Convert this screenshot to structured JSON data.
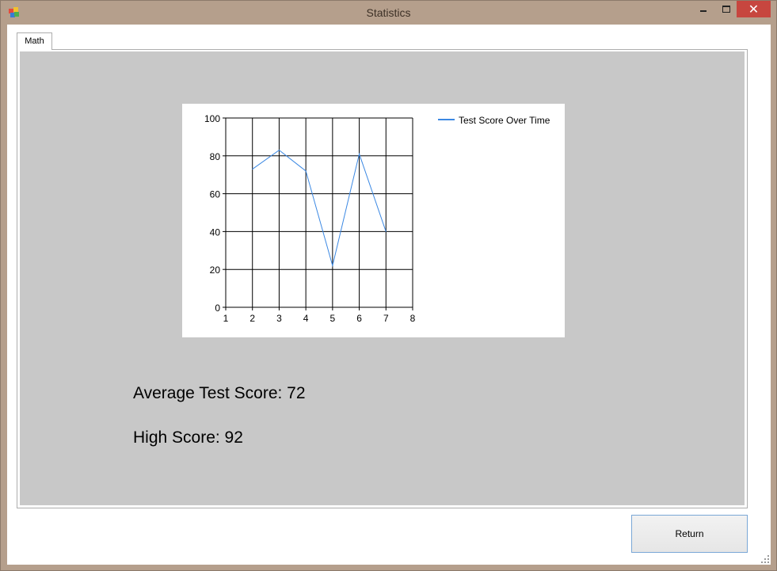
{
  "window": {
    "title": "Statistics"
  },
  "tabs": [
    {
      "label": "Math"
    }
  ],
  "chart_data": {
    "type": "line",
    "legend": "Test Score Over Time",
    "legend_position": "top-right",
    "series": [
      {
        "name": "Test Score Over Time",
        "color": "#3b88e3",
        "x": [
          2,
          3,
          4,
          5,
          6,
          7
        ],
        "y": [
          73,
          83,
          72,
          22,
          81,
          40
        ]
      }
    ],
    "xlim": [
      1,
      8
    ],
    "ylim": [
      0,
      100
    ],
    "xticks": [
      1,
      2,
      3,
      4,
      5,
      6,
      7,
      8
    ],
    "yticks": [
      0,
      20,
      40,
      60,
      80,
      100
    ],
    "grid": true
  },
  "stats": {
    "average_label": "Average Test Score: 72",
    "high_label": "High Score: 92"
  },
  "buttons": {
    "return_label": "Return"
  }
}
